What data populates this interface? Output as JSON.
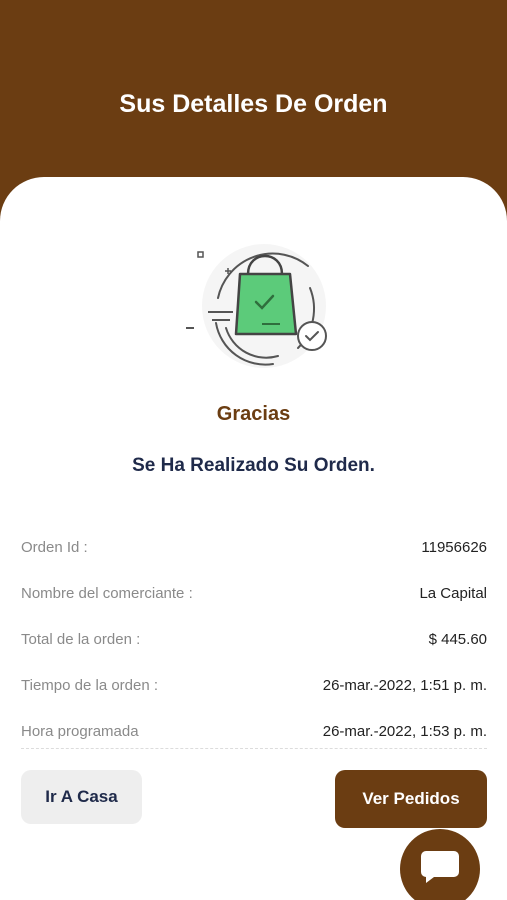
{
  "header": {
    "title": "Sus Detalles De Orden"
  },
  "confirmation": {
    "illustration_icon": "shopping-bag-check-icon",
    "thanks": "Gracias",
    "message": "Se Ha Realizado Su Orden."
  },
  "details": [
    {
      "label": "Orden Id :",
      "value": "11956626"
    },
    {
      "label": "Nombre del comerciante :",
      "value": "La Capital"
    },
    {
      "label": "Total de la orden :",
      "value": "$ 445.60"
    },
    {
      "label": "Tiempo de la orden :",
      "value": "26-mar.-2022, 1:51 p. m."
    },
    {
      "label": "Hora programada",
      "value": "26-mar.-2022, 1:53 p. m."
    }
  ],
  "actions": {
    "home_label": "Ir A Casa",
    "orders_label": "Ver Pedidos"
  },
  "chat": {
    "icon": "chat-bubble-icon"
  },
  "colors": {
    "brand": "#6b3d12",
    "bag_green": "#5ccb7a",
    "title_navy": "#1f2a4a"
  }
}
